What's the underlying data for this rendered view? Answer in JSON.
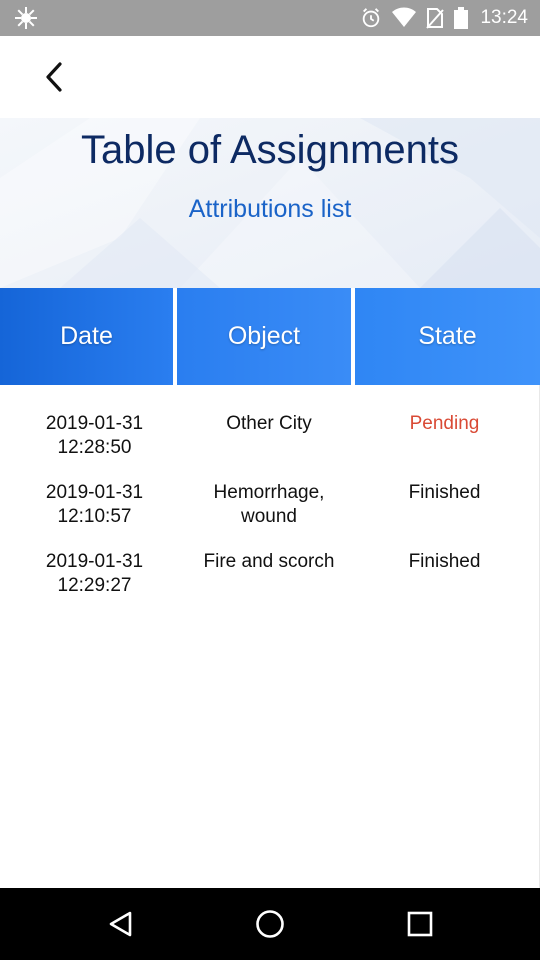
{
  "status_bar": {
    "time": "13:24",
    "icons": [
      "notification-icon",
      "alarm-icon",
      "wifi-icon",
      "no-sim-icon",
      "battery-icon"
    ]
  },
  "header": {
    "back_icon": "chevron-left-icon"
  },
  "hero": {
    "title": "Table of Assignments",
    "subtitle": "Attributions list"
  },
  "table": {
    "columns": [
      "Date",
      "Object",
      "State"
    ],
    "rows": [
      {
        "date": "2019-01-31",
        "time": "12:28:50",
        "object_line1": "Other City",
        "object_line2": "",
        "state": "Pending"
      },
      {
        "date": "2019-01-31",
        "time": "12:10:57",
        "object_line1": "Hemorrhage,",
        "object_line2": "wound",
        "state": "Finished"
      },
      {
        "date": "2019-01-31",
        "time": "12:29:27",
        "object_line1": "Fire and scorch",
        "object_line2": "",
        "state": "Finished"
      }
    ]
  },
  "nav_bar": {
    "buttons": [
      "back-triangle-icon",
      "home-circle-icon",
      "recents-square-icon"
    ]
  },
  "colors": {
    "title": "#0d2a63",
    "subtitle": "#1a63c8",
    "header_blue": "#2a7ef0",
    "pending": "#d94a35"
  }
}
